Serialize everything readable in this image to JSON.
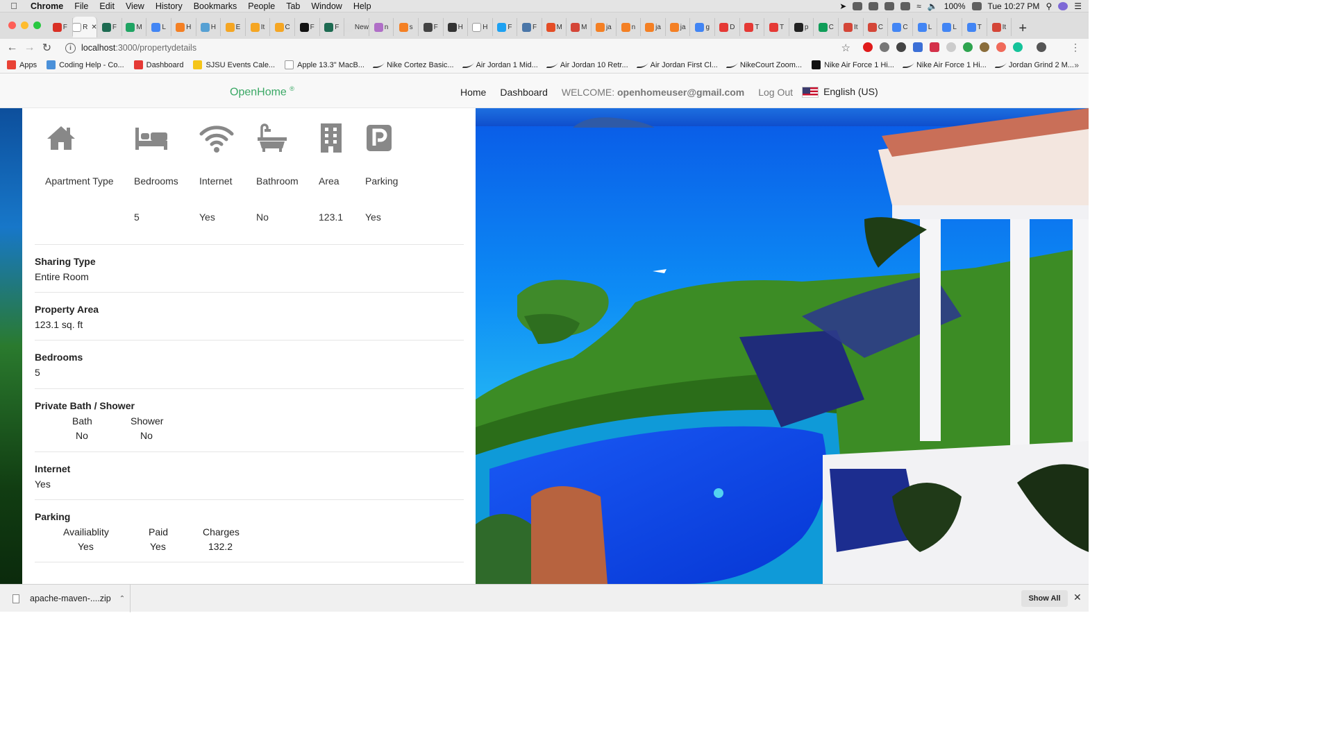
{
  "menubar": {
    "app": "Chrome",
    "items": [
      "File",
      "Edit",
      "View",
      "History",
      "Bookmarks",
      "People",
      "Tab",
      "Window",
      "Help"
    ],
    "battery": "100%",
    "clock": "Tue 10:27 PM"
  },
  "tabs": [
    {
      "label": "F",
      "color": "#d93025"
    },
    {
      "label": "R",
      "color": "#ffffff",
      "active": true
    },
    {
      "label": "F",
      "color": "#1e6b52"
    },
    {
      "label": "M",
      "color": "#1fa463"
    },
    {
      "label": "L",
      "color": "#4285f4"
    },
    {
      "label": "H",
      "color": "#f48024"
    },
    {
      "label": "H",
      "color": "#56a0d3"
    },
    {
      "label": "E",
      "color": "#f5a623"
    },
    {
      "label": "It",
      "color": "#f5a623"
    },
    {
      "label": "C",
      "color": "#f5a623"
    },
    {
      "label": "F",
      "color": "#111111"
    },
    {
      "label": "F",
      "color": "#1e6b52"
    },
    {
      "label": "New",
      "color": "#dddddd"
    },
    {
      "label": "n",
      "color": "#b06fc7"
    },
    {
      "label": "s",
      "color": "#f48024"
    },
    {
      "label": "F",
      "color": "#444444"
    },
    {
      "label": "H",
      "color": "#333333"
    },
    {
      "label": "H",
      "color": "#ffffff"
    },
    {
      "label": "F",
      "color": "#1da1f2"
    },
    {
      "label": "F",
      "color": "#4a76a8"
    },
    {
      "label": "M",
      "color": "#e44d26"
    },
    {
      "label": "M",
      "color": "#d44638"
    },
    {
      "label": "ja",
      "color": "#f48024"
    },
    {
      "label": "n",
      "color": "#f48024"
    },
    {
      "label": "ja",
      "color": "#f48024"
    },
    {
      "label": "ja",
      "color": "#f48024"
    },
    {
      "label": "g",
      "color": "#4285f4"
    },
    {
      "label": "D",
      "color": "#e53935"
    },
    {
      "label": "T",
      "color": "#e53935"
    },
    {
      "label": "T",
      "color": "#e53935"
    },
    {
      "label": "p",
      "color": "#222222"
    },
    {
      "label": "C",
      "color": "#0f9d58"
    },
    {
      "label": "It",
      "color": "#d44638"
    },
    {
      "label": "C",
      "color": "#d44638"
    },
    {
      "label": "C",
      "color": "#4285f4"
    },
    {
      "label": "L",
      "color": "#4285f4"
    },
    {
      "label": "L",
      "color": "#4285f4"
    },
    {
      "label": "T",
      "color": "#4285f4"
    },
    {
      "label": "It",
      "color": "#d44638"
    }
  ],
  "address": {
    "host": "localhost",
    "path": ":3000/propertydetails"
  },
  "bookmarks": [
    {
      "label": "Apps",
      "color": "#e94235"
    },
    {
      "label": "Coding Help - Co...",
      "color": "#4a90d9"
    },
    {
      "label": "Dashboard",
      "color": "#e53935"
    },
    {
      "label": "SJSU Events Cale...",
      "color": "#f5c518"
    },
    {
      "label": "Apple 13.3\" MacB...",
      "color": "#ffffff"
    },
    {
      "label": "Nike Cortez Basic...",
      "swoosh": true
    },
    {
      "label": "Air Jordan 1 Mid...",
      "swoosh": true
    },
    {
      "label": "Air Jordan 10 Retr...",
      "swoosh": true
    },
    {
      "label": "Air Jordan First Cl...",
      "swoosh": true
    },
    {
      "label": "NikeCourt Zoom...",
      "swoosh": true
    },
    {
      "label": "Nike Air Force 1 Hi...",
      "color": "#111111"
    },
    {
      "label": "Nike Air Force 1 Hi...",
      "swoosh": true
    },
    {
      "label": "Jordan Grind 2 M...",
      "swoosh": true
    }
  ],
  "app": {
    "brand": "OpenHome",
    "brand_mark": "®",
    "nav": {
      "home": "Home",
      "dashboard": "Dashboard",
      "welcome_prefix": "WELCOME: ",
      "user_email": "openhomeuser@gmail.com",
      "logout": "Log Out",
      "language": "English (US)"
    }
  },
  "amenities": [
    {
      "label": "Apartment Type",
      "value": "",
      "icon": "home-icon"
    },
    {
      "label": "Bedrooms",
      "value": "5",
      "icon": "bed-icon"
    },
    {
      "label": "Internet",
      "value": "Yes",
      "icon": "wifi-icon"
    },
    {
      "label": "Bathroom",
      "value": "No",
      "icon": "bathtub-icon"
    },
    {
      "label": "Area",
      "value": "123.1",
      "icon": "building-icon"
    },
    {
      "label": "Parking",
      "value": "Yes",
      "icon": "parking-icon"
    }
  ],
  "details": {
    "sharing": {
      "title": "Sharing Type",
      "value": "Entire Room"
    },
    "area": {
      "title": "Property Area",
      "value": "123.1 sq. ft"
    },
    "bedrooms": {
      "title": "Bedrooms",
      "value": "5"
    },
    "bath": {
      "title": "Private Bath / Shower",
      "headers": [
        "Bath",
        "Shower"
      ],
      "values": [
        "No",
        "No"
      ]
    },
    "internet": {
      "title": "Internet",
      "value": "Yes"
    },
    "parking": {
      "title": "Parking",
      "headers": [
        "Availiablity",
        "Paid",
        "Charges"
      ],
      "values": [
        "Yes",
        "Yes",
        "132.2"
      ]
    }
  },
  "downloads": {
    "file": "apache-maven-....zip",
    "show_all": "Show All"
  }
}
